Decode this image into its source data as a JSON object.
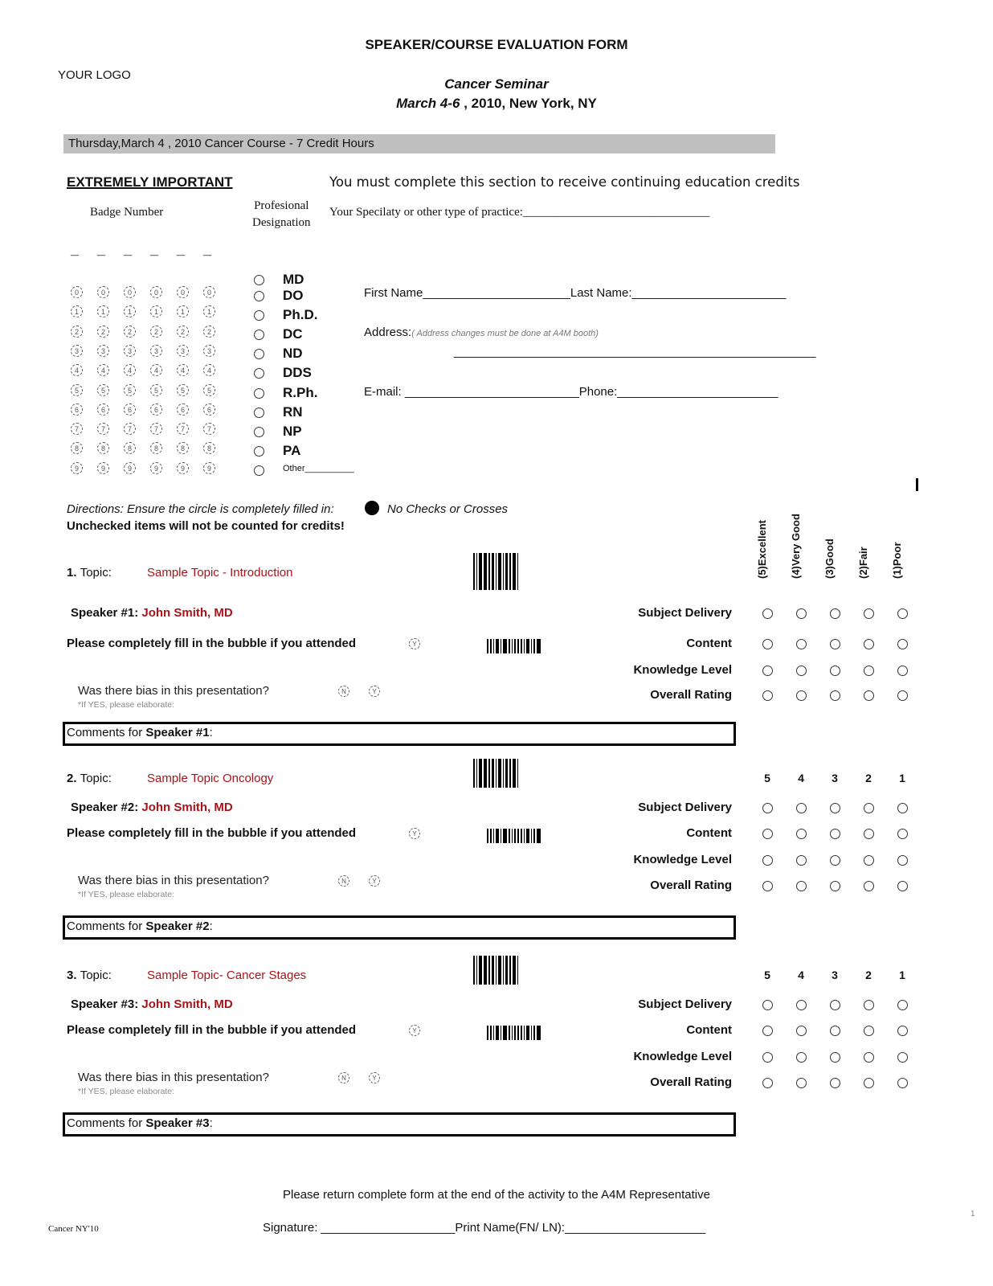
{
  "header": {
    "title": "SPEAKER/COURSE EVALUATION FORM",
    "logo": "YOUR LOGO",
    "event_name": "Cancer  Seminar",
    "event_dates_italic": "March 4-6",
    "event_dates_rest": " , 2010, New York, NY",
    "day_bar": "Thursday,March 4 , 2010 Cancer Course - 7 Credit Hours"
  },
  "registration": {
    "important_label": "EXTREMELY IMPORTANT",
    "must_complete": "You must complete this section to receive continuing education credits",
    "badge_header": "Badge Number",
    "prof_header_line1": "Profesional",
    "prof_header_line2": "Designation",
    "specialty_label": "Your Specilaty or other type of practice:_______________________________",
    "badge_digits": [
      "0",
      "1",
      "2",
      "3",
      "4",
      "5",
      "6",
      "7",
      "8",
      "9"
    ],
    "badge_columns": 6,
    "designations": [
      "MD",
      "DO",
      "Ph.D.",
      "DC",
      "ND",
      "DDS",
      "R.Ph.",
      "RN",
      "NP",
      "PA"
    ],
    "other_label": "Other__________",
    "first_name": "First Name______________________Last Name:_______________________",
    "address_label": "Address:",
    "address_note": "( Address changes must be done at A4M booth)",
    "address_line": "______________________________________________________",
    "email": "E-mail: __________________________Phone:________________________"
  },
  "directions": {
    "text": "Directions: Ensure the circle is completely filled in:",
    "no_checks": "No Checks or Crosses",
    "unchecked": "Unchecked items will not be counted for credits!"
  },
  "rating_scale": {
    "labels": [
      "(5)Excellent",
      "(4)Very Good",
      "(3)Good",
      "(2)Fair",
      "(1)Poor"
    ],
    "numbers": [
      "5",
      "4",
      "3",
      "2",
      "1"
    ]
  },
  "criteria": [
    "Subject Delivery",
    "Content",
    "Knowledge Level",
    "Overall Rating"
  ],
  "sections": [
    {
      "number": "1.",
      "topic_label": "Topic:",
      "topic": "Sample Topic - Introduction",
      "speaker_label": "Speaker #1:",
      "speaker": "John Smith, MD",
      "attended": "Please completely fill in the bubble if you attended",
      "bias": "Was there bias in this presentation?",
      "elaborate": "*If YES, please elaborate:",
      "comments_prefix": "Comments for ",
      "comments_bold": "Speaker #1",
      "comments_suffix": ":"
    },
    {
      "number": "2.",
      "topic_label": "Topic:",
      "topic": "Sample Topic Oncology",
      "speaker_label": "Speaker #2:",
      "speaker": "John Smith, MD",
      "attended": "Please completely fill in the bubble if you attended",
      "bias": "Was there bias in this presentation?",
      "elaborate": "*If YES, please elaborate:",
      "comments_prefix": "Comments for ",
      "comments_bold": "Speaker #2",
      "comments_suffix": ":"
    },
    {
      "number": "3.",
      "topic_label": "Topic:",
      "topic": "Sample Topic- Cancer Stages",
      "speaker_label": "Speaker #3:",
      "speaker": "John Smith, MD",
      "attended": "Please completely fill in the bubble if you attended",
      "bias": "Was there bias in this presentation?",
      "elaborate": "*If YES, please elaborate:",
      "comments_prefix": "Comments for ",
      "comments_bold": "Speaker #3",
      "comments_suffix": ":"
    }
  ],
  "bubble_letters": {
    "yes": "Y",
    "no": "N"
  },
  "footer": {
    "return_note": "Please return complete form at the end of the activity to the A4M Representative",
    "code": "Cancer NY'10",
    "signature": "Signature: ____________________Print Name(FN/ LN):_____________________",
    "page_number": "1"
  }
}
